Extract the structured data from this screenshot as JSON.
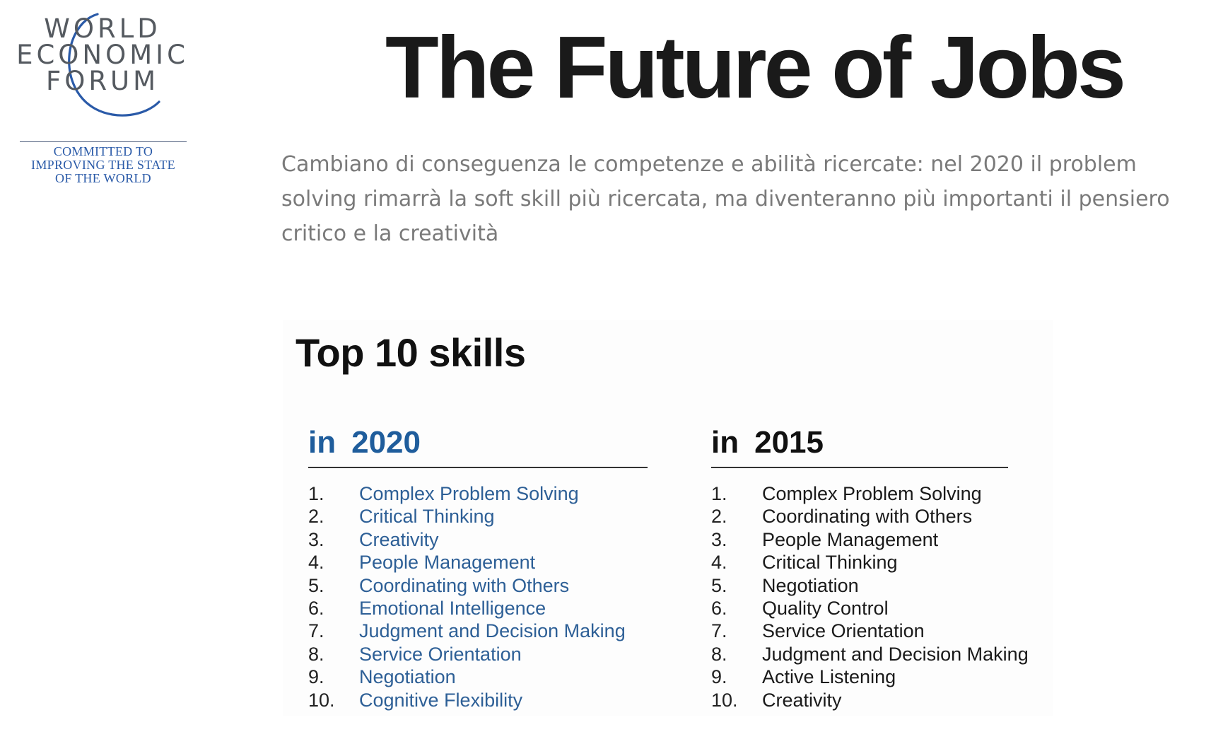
{
  "logo": {
    "line1": "WORLD",
    "line2": "ECONOMIC",
    "line3": "FORUM",
    "tagline_1": "COMMITTED TO",
    "tagline_2": "IMPROVING THE STATE",
    "tagline_3": "OF THE WORLD",
    "text_color": "#555a60",
    "accent_color": "#2a5aa8"
  },
  "title": "The Future of Jobs",
  "subtitle": "Cambiano di conseguenza le competenze e abilità ricercate: nel 2020 il problem solving rimarrà la soft skill più ricercata, ma diventeranno più importanti il pensiero critico e la creatività",
  "panel": {
    "title": "Top 10 skills",
    "columns": [
      {
        "in_label": "in",
        "year": "2020",
        "color": "#1f5d9c",
        "items": [
          {
            "rank": "1.",
            "name": "Complex Problem Solving"
          },
          {
            "rank": "2.",
            "name": "Critical Thinking"
          },
          {
            "rank": "3.",
            "name": "Creativity"
          },
          {
            "rank": "4.",
            "name": "People Management"
          },
          {
            "rank": "5.",
            "name": "Coordinating with Others"
          },
          {
            "rank": "6.",
            "name": "Emotional Intelligence"
          },
          {
            "rank": "7.",
            "name": "Judgment and Decision Making"
          },
          {
            "rank": "8.",
            "name": "Service Orientation"
          },
          {
            "rank": "9.",
            "name": "Negotiation"
          },
          {
            "rank": "10.",
            "name": "Cognitive Flexibility"
          }
        ]
      },
      {
        "in_label": "in",
        "year": "2015",
        "color": "#111111",
        "items": [
          {
            "rank": "1.",
            "name": "Complex Problem Solving"
          },
          {
            "rank": "2.",
            "name": "Coordinating with Others"
          },
          {
            "rank": "3.",
            "name": "People Management"
          },
          {
            "rank": "4.",
            "name": "Critical Thinking"
          },
          {
            "rank": "5.",
            "name": "Negotiation"
          },
          {
            "rank": "6.",
            "name": "Quality Control"
          },
          {
            "rank": "7.",
            "name": "Service Orientation"
          },
          {
            "rank": "8.",
            "name": "Judgment and Decision Making"
          },
          {
            "rank": "9.",
            "name": "Active Listening"
          },
          {
            "rank": "10.",
            "name": "Creativity"
          }
        ]
      }
    ]
  }
}
